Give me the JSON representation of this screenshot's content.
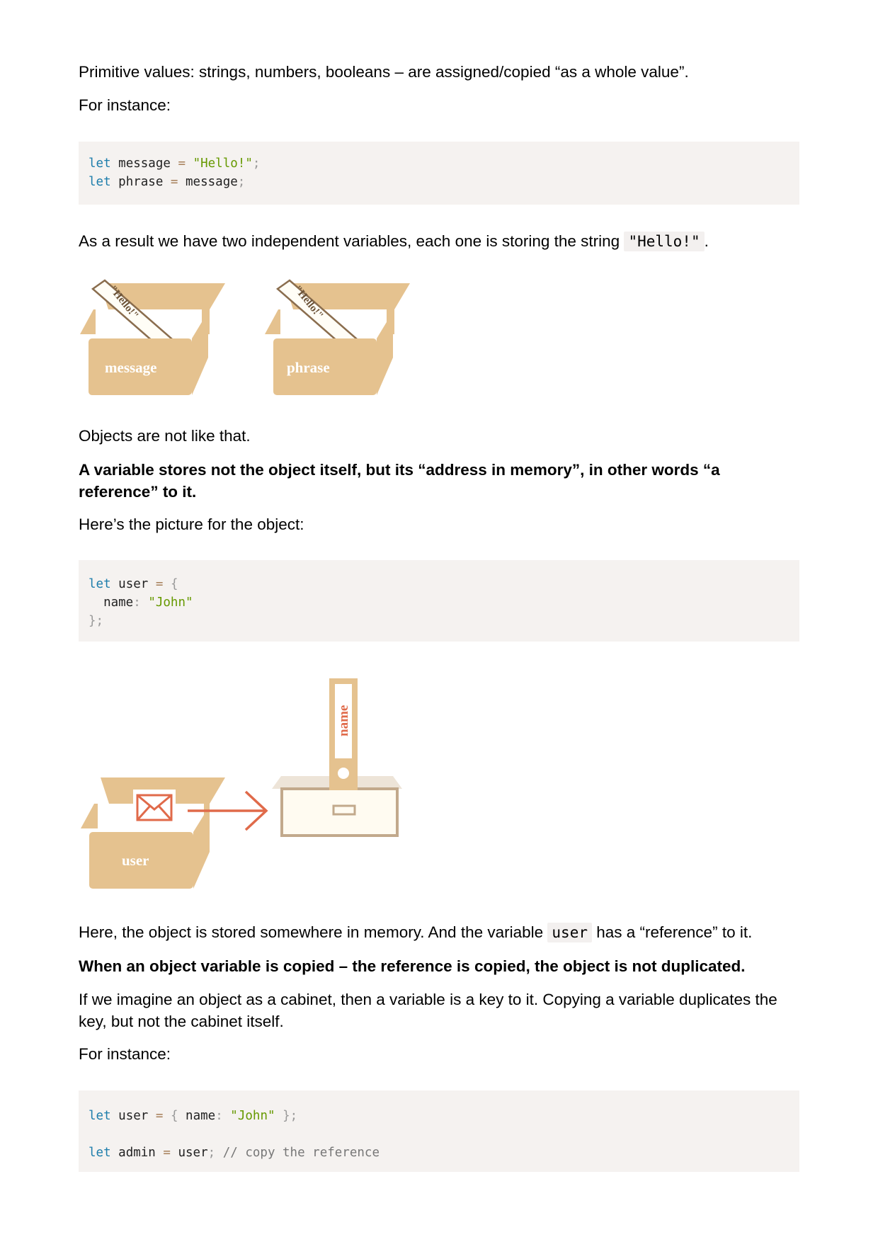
{
  "p1": "Primitive values: strings, numbers, booleans – are assigned/copied “as a whole value”.",
  "p2": "For instance:",
  "code1": {
    "line1": {
      "kw": "let",
      "name": "message",
      "op": "=",
      "str": "\"Hello!\"",
      "end": ";"
    },
    "line2": {
      "kw": "let",
      "name": "phrase",
      "op": "=",
      "ref": "message",
      "end": ";"
    }
  },
  "p3": {
    "before": "As a result we have two independent variables, each one is storing the string ",
    "code": "\"Hello!\"",
    "after": "."
  },
  "figure1": {
    "box1_label": "message",
    "box1_paper": "\"Hello!\"",
    "box2_label": "phrase",
    "box2_paper": "\"Hello!\""
  },
  "p4": "Objects are not like that.",
  "p5": "A variable stores not the object itself, but its “address in memory”, in other words “a reference” to it.",
  "p6": "Here’s the picture for the object:",
  "code2": {
    "line1": {
      "kw": "let",
      "name": "user",
      "op": "=",
      "brace": "{"
    },
    "line2": {
      "key": "name",
      "colon": ":",
      "str": "\"John\""
    },
    "line3": {
      "close": "};"
    }
  },
  "figure2": {
    "box_label": "user",
    "folder_label": "name"
  },
  "p7": {
    "before": "Here, the object is stored somewhere in memory. And the variable ",
    "code": "user",
    "after": " has a “reference” to it."
  },
  "p8": "When an object variable is copied – the reference is copied, the object is not duplicated.",
  "p9": "If we imagine an object as a cabinet, then a variable is a key to it. Copying a variable duplicates the key, but not the cabinet itself.",
  "p10": "For instance:",
  "code3": {
    "line1": {
      "kw": "let",
      "name": "user",
      "op": "=",
      "open": "{",
      "key": "name",
      "colon": ":",
      "str": "\"John\"",
      "close": "};"
    },
    "line3": {
      "kw": "let",
      "name": "admin",
      "op": "=",
      "ref": "user",
      "end": ";",
      "comment": "// copy the reference"
    }
  },
  "colors": {
    "box": "#e5c28f",
    "arrow": "#e06a4a",
    "code_bg": "#f5f2f0",
    "keyword": "#1d7dab",
    "string": "#669900"
  }
}
